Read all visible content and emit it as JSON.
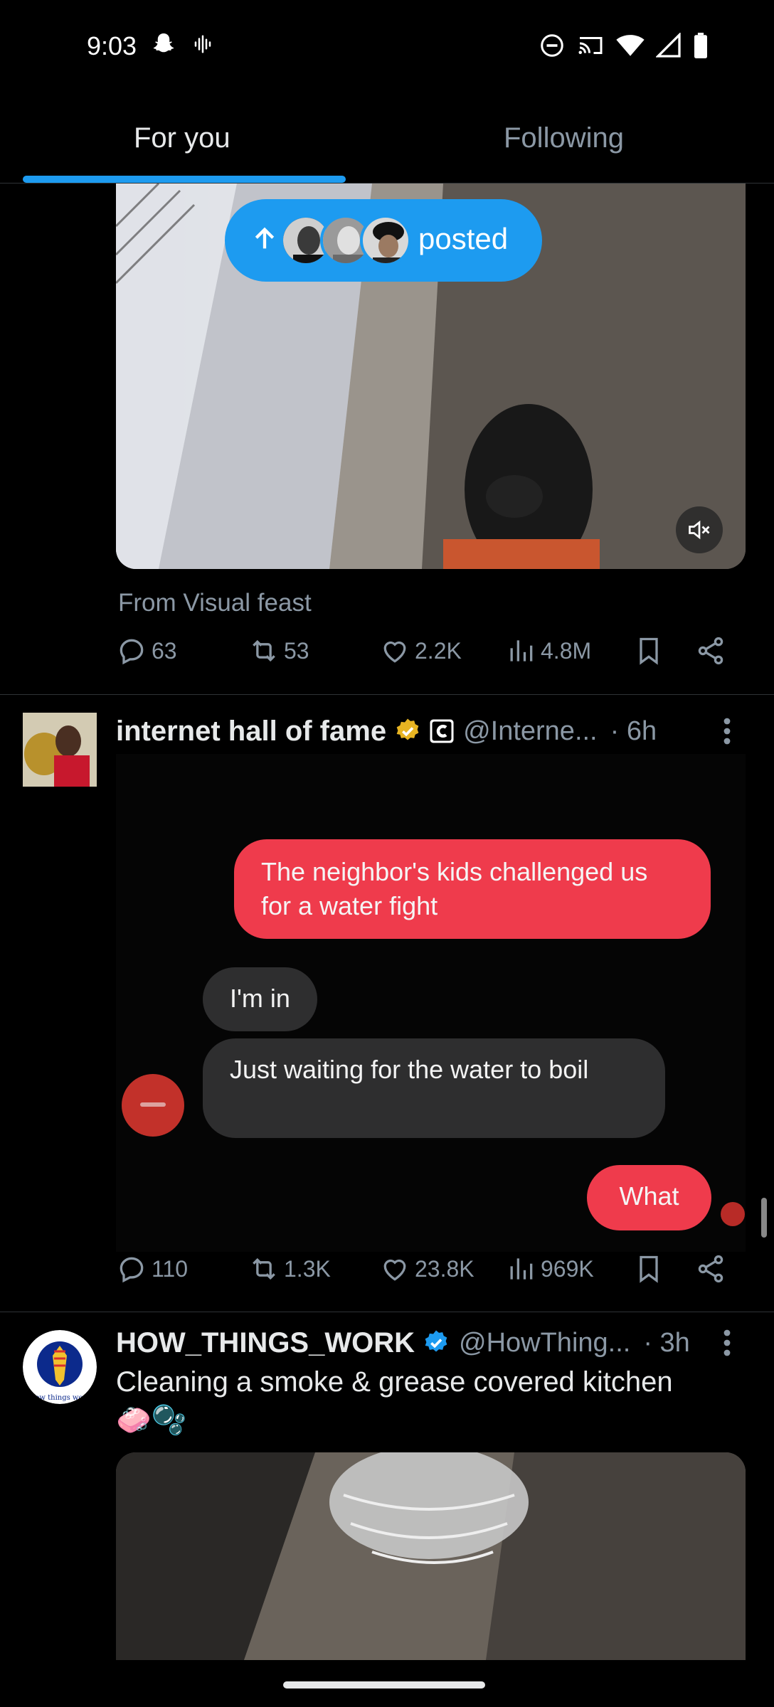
{
  "status_bar": {
    "time": "9:03",
    "left_icons": [
      "snapchat-icon",
      "sound-wave-icon"
    ],
    "right_icons": [
      "do-not-disturb-icon",
      "cast-icon",
      "wifi-icon",
      "signal-icon",
      "battery-icon"
    ]
  },
  "tabs": [
    {
      "label": "For you",
      "selected": true
    },
    {
      "label": "Following",
      "selected": false
    }
  ],
  "accent_color": "#1d9bf0",
  "new_posts_pill": {
    "label": "posted",
    "icon": "arrow-up-icon",
    "avatar_count": 3
  },
  "post1": {
    "source": "From Visual feast",
    "media": {
      "type": "video",
      "muted": true
    },
    "actions": {
      "replies": "63",
      "reposts": "53",
      "likes": "2.2K",
      "views": "4.8M"
    }
  },
  "post2": {
    "name": "internet hall of fame",
    "handle": "@Interne...",
    "time": "· 6h",
    "badges": [
      "gold-verified-icon",
      "affiliate-badge-icon"
    ],
    "media_chat": {
      "sent1": "The neighbor's kids challenged us for a water fight",
      "recv1": "I'm in",
      "recv2": "Just waiting for the water to boil",
      "sent2": "What"
    },
    "actions": {
      "replies": "110",
      "reposts": "1.3K",
      "likes": "23.8K",
      "views": "969K"
    }
  },
  "post3": {
    "name": "HOW_THINGS_WORK",
    "handle": "@HowThing...",
    "time": "· 3h",
    "badges": [
      "blue-verified-icon"
    ],
    "text": "Cleaning a smoke & grease covered kitchen",
    "emoji": "🧼🫧",
    "avatar_text": "How things work"
  }
}
